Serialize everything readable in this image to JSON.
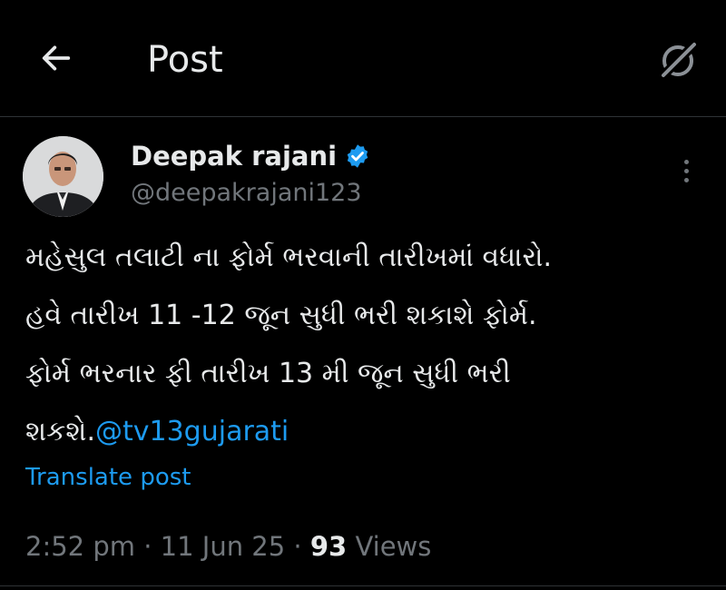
{
  "header": {
    "title": "Post",
    "back_icon": "arrow-left-icon",
    "grok_icon": "grok-icon"
  },
  "author": {
    "name": "Deepak rajani",
    "handle": "@deepakrajani123",
    "verified": true,
    "verified_color": "#1d9bf0"
  },
  "post": {
    "text_lines": [
      "મહેસુલ તલાટી ના ફોર્મ ભરવાની તારીખમાં વધારો.",
      "હવે તારીખ 11 -12 જૂન સુધી ભરી શકાશે ફોર્મ.",
      "ફોર્મ ભરનાર ફી તારીખ 13 મી જૂન સુધી ભરી",
      "શકશે."
    ],
    "mention": "@tv13gujarati",
    "translate_label": "Translate post"
  },
  "meta": {
    "time": "2:52 pm",
    "separator": " · ",
    "date": "11 Jun 25",
    "views_count": "93",
    "views_label": " Views"
  },
  "colors": {
    "background": "#000000",
    "text": "#e7e9ea",
    "muted": "#71767b",
    "accent": "#1d9bf0"
  }
}
